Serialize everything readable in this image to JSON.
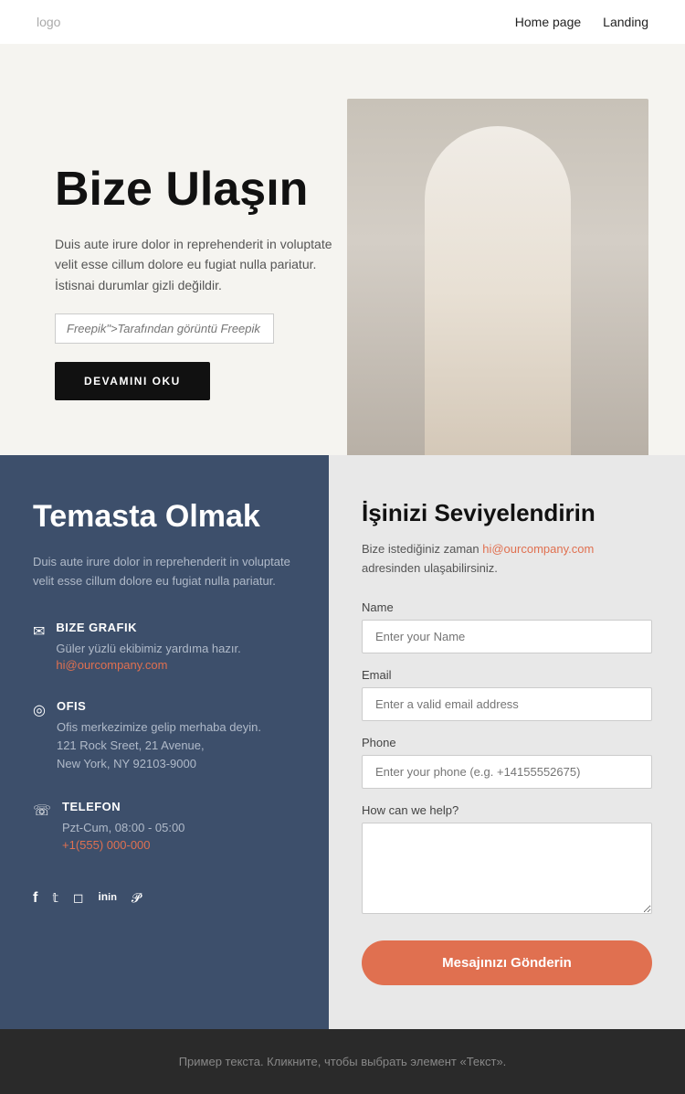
{
  "nav": {
    "logo": "logo",
    "links": [
      {
        "label": "Home page"
      },
      {
        "label": "Landing"
      }
    ]
  },
  "hero": {
    "title": "Bize Ulaşın",
    "description": "Duis aute irure dolor in reprehenderit in voluptate velit esse cillum dolore eu fugiat nulla pariatur. İstisnai durumlar gizli değildir.",
    "input_placeholder": "Freepik\">Tarafından görüntü Freepik",
    "button_label": "DEVAMINI OKU"
  },
  "contact_left": {
    "title": "Temasta Olmak",
    "description": "Duis aute irure dolor in reprehenderit in voluptate velit esse cillum dolore eu fugiat nulla pariatur.",
    "items": [
      {
        "icon": "envelope",
        "label": "BIZE GRAFIK",
        "text": "Güler yüzlü ekibimiz yardıma hazır.",
        "link": "hi@ourcompany.com"
      },
      {
        "icon": "location",
        "label": "OFIS",
        "text": "Ofis merkezimize gelip merhaba deyin.",
        "address_lines": [
          "121 Rock Sreet, 21 Avenue,",
          "New York, NY 92103-9000"
        ]
      },
      {
        "icon": "phone",
        "label": "TELEFON",
        "text": "Pzt-Cum, 08:00 - 05:00",
        "link": "+1(555) 000-000"
      }
    ],
    "social": [
      "f",
      "t",
      "i",
      "in",
      "p"
    ]
  },
  "contact_right": {
    "title": "İşinizi Seviyelendirin",
    "description_prefix": "Bize istediğiniz zaman ",
    "email": "hi@ourcompany.com",
    "description_suffix": " adresinden ulaşabilirsiniz.",
    "form": {
      "name_label": "Name",
      "name_placeholder": "Enter your Name",
      "email_label": "Email",
      "email_placeholder": "Enter a valid email address",
      "phone_label": "Phone",
      "phone_placeholder": "Enter your phone (e.g. +14155552675)",
      "message_label": "How can we help?",
      "message_placeholder": "",
      "submit_label": "Mesajınızı Gönderin"
    }
  },
  "footer": {
    "text": "Пример текста. Кликните, чтобы выбрать элемент «Текст»."
  }
}
